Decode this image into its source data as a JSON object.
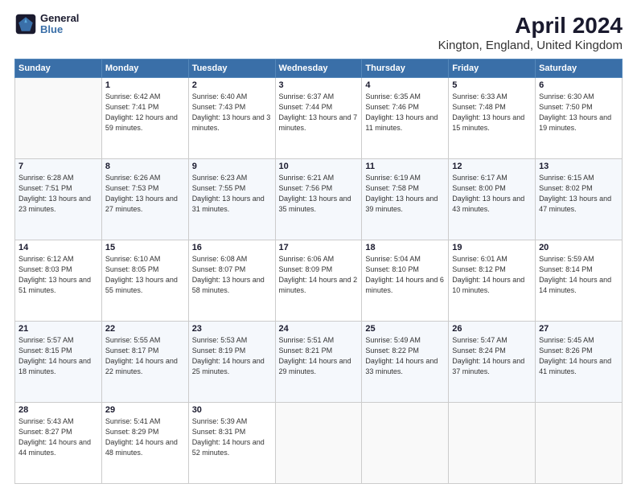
{
  "app": {
    "logo_line1": "General",
    "logo_line2": "Blue"
  },
  "title": "April 2024",
  "subtitle": "Kington, England, United Kingdom",
  "days_of_week": [
    "Sunday",
    "Monday",
    "Tuesday",
    "Wednesday",
    "Thursday",
    "Friday",
    "Saturday"
  ],
  "weeks": [
    [
      null,
      {
        "day": "1",
        "sunrise": "6:42 AM",
        "sunset": "7:41 PM",
        "daylight": "12 hours and 59 minutes."
      },
      {
        "day": "2",
        "sunrise": "6:40 AM",
        "sunset": "7:43 PM",
        "daylight": "13 hours and 3 minutes."
      },
      {
        "day": "3",
        "sunrise": "6:37 AM",
        "sunset": "7:44 PM",
        "daylight": "13 hours and 7 minutes."
      },
      {
        "day": "4",
        "sunrise": "6:35 AM",
        "sunset": "7:46 PM",
        "daylight": "13 hours and 11 minutes."
      },
      {
        "day": "5",
        "sunrise": "6:33 AM",
        "sunset": "7:48 PM",
        "daylight": "13 hours and 15 minutes."
      },
      {
        "day": "6",
        "sunrise": "6:30 AM",
        "sunset": "7:50 PM",
        "daylight": "13 hours and 19 minutes."
      }
    ],
    [
      {
        "day": "7",
        "sunrise": "6:28 AM",
        "sunset": "7:51 PM",
        "daylight": "13 hours and 23 minutes."
      },
      {
        "day": "8",
        "sunrise": "6:26 AM",
        "sunset": "7:53 PM",
        "daylight": "13 hours and 27 minutes."
      },
      {
        "day": "9",
        "sunrise": "6:23 AM",
        "sunset": "7:55 PM",
        "daylight": "13 hours and 31 minutes."
      },
      {
        "day": "10",
        "sunrise": "6:21 AM",
        "sunset": "7:56 PM",
        "daylight": "13 hours and 35 minutes."
      },
      {
        "day": "11",
        "sunrise": "6:19 AM",
        "sunset": "7:58 PM",
        "daylight": "13 hours and 39 minutes."
      },
      {
        "day": "12",
        "sunrise": "6:17 AM",
        "sunset": "8:00 PM",
        "daylight": "13 hours and 43 minutes."
      },
      {
        "day": "13",
        "sunrise": "6:15 AM",
        "sunset": "8:02 PM",
        "daylight": "13 hours and 47 minutes."
      }
    ],
    [
      {
        "day": "14",
        "sunrise": "6:12 AM",
        "sunset": "8:03 PM",
        "daylight": "13 hours and 51 minutes."
      },
      {
        "day": "15",
        "sunrise": "6:10 AM",
        "sunset": "8:05 PM",
        "daylight": "13 hours and 55 minutes."
      },
      {
        "day": "16",
        "sunrise": "6:08 AM",
        "sunset": "8:07 PM",
        "daylight": "13 hours and 58 minutes."
      },
      {
        "day": "17",
        "sunrise": "6:06 AM",
        "sunset": "8:09 PM",
        "daylight": "14 hours and 2 minutes."
      },
      {
        "day": "18",
        "sunrise": "5:04 AM",
        "sunset": "8:10 PM",
        "daylight": "14 hours and 6 minutes."
      },
      {
        "day": "19",
        "sunrise": "6:01 AM",
        "sunset": "8:12 PM",
        "daylight": "14 hours and 10 minutes."
      },
      {
        "day": "20",
        "sunrise": "5:59 AM",
        "sunset": "8:14 PM",
        "daylight": "14 hours and 14 minutes."
      }
    ],
    [
      {
        "day": "21",
        "sunrise": "5:57 AM",
        "sunset": "8:15 PM",
        "daylight": "14 hours and 18 minutes."
      },
      {
        "day": "22",
        "sunrise": "5:55 AM",
        "sunset": "8:17 PM",
        "daylight": "14 hours and 22 minutes."
      },
      {
        "day": "23",
        "sunrise": "5:53 AM",
        "sunset": "8:19 PM",
        "daylight": "14 hours and 25 minutes."
      },
      {
        "day": "24",
        "sunrise": "5:51 AM",
        "sunset": "8:21 PM",
        "daylight": "14 hours and 29 minutes."
      },
      {
        "day": "25",
        "sunrise": "5:49 AM",
        "sunset": "8:22 PM",
        "daylight": "14 hours and 33 minutes."
      },
      {
        "day": "26",
        "sunrise": "5:47 AM",
        "sunset": "8:24 PM",
        "daylight": "14 hours and 37 minutes."
      },
      {
        "day": "27",
        "sunrise": "5:45 AM",
        "sunset": "8:26 PM",
        "daylight": "14 hours and 41 minutes."
      }
    ],
    [
      {
        "day": "28",
        "sunrise": "5:43 AM",
        "sunset": "8:27 PM",
        "daylight": "14 hours and 44 minutes."
      },
      {
        "day": "29",
        "sunrise": "5:41 AM",
        "sunset": "8:29 PM",
        "daylight": "14 hours and 48 minutes."
      },
      {
        "day": "30",
        "sunrise": "5:39 AM",
        "sunset": "8:31 PM",
        "daylight": "14 hours and 52 minutes."
      },
      null,
      null,
      null,
      null
    ]
  ]
}
